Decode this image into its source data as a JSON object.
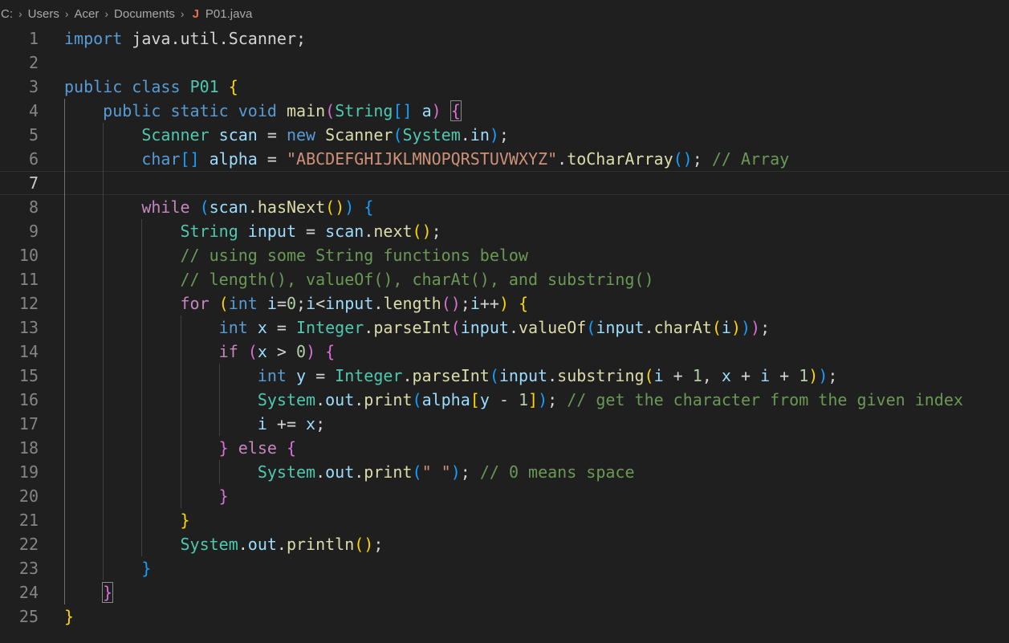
{
  "breadcrumb": {
    "items": [
      "C:",
      "Users",
      "Acer",
      "Documents"
    ],
    "file_icon": "J",
    "file": "P01.java"
  },
  "editor": {
    "language": "java",
    "current_line": 7,
    "lines": [
      {
        "n": "1",
        "t": [
          [
            "kw",
            "import"
          ],
          [
            "p",
            " java.util.Scanner;"
          ]
        ]
      },
      {
        "n": "2",
        "t": []
      },
      {
        "n": "3",
        "t": [
          [
            "kw",
            "public"
          ],
          [
            "p",
            " "
          ],
          [
            "kw",
            "class"
          ],
          [
            "p",
            " "
          ],
          [
            "ty",
            "P01"
          ],
          [
            "p",
            " "
          ],
          [
            "b1",
            "{"
          ]
        ]
      },
      {
        "n": "4",
        "t": [
          [
            "p",
            "    "
          ],
          [
            "kw",
            "public"
          ],
          [
            "p",
            " "
          ],
          [
            "kw",
            "static"
          ],
          [
            "p",
            " "
          ],
          [
            "kw",
            "void"
          ],
          [
            "p",
            " "
          ],
          [
            "fn",
            "main"
          ],
          [
            "b2",
            "("
          ],
          [
            "ty",
            "String"
          ],
          [
            "b3",
            "[]"
          ],
          [
            "p",
            " "
          ],
          [
            "var",
            "a"
          ],
          [
            "b2",
            ")"
          ],
          [
            "p",
            " "
          ],
          [
            "b2m",
            "{"
          ]
        ]
      },
      {
        "n": "5",
        "t": [
          [
            "p",
            "        "
          ],
          [
            "ty",
            "Scanner"
          ],
          [
            "p",
            " "
          ],
          [
            "var",
            "scan"
          ],
          [
            "p",
            " = "
          ],
          [
            "kw",
            "new"
          ],
          [
            "p",
            " "
          ],
          [
            "fn",
            "Scanner"
          ],
          [
            "b3",
            "("
          ],
          [
            "ty",
            "System"
          ],
          [
            "p",
            "."
          ],
          [
            "var",
            "in"
          ],
          [
            "b3",
            ")"
          ],
          [
            "p",
            ";"
          ]
        ]
      },
      {
        "n": "6",
        "t": [
          [
            "p",
            "        "
          ],
          [
            "kw",
            "char"
          ],
          [
            "b3",
            "[]"
          ],
          [
            "p",
            " "
          ],
          [
            "var",
            "alpha"
          ],
          [
            "p",
            " = "
          ],
          [
            "str",
            "\"ABCDEFGHIJKLMNOPQRSTUVWXYZ\""
          ],
          [
            "p",
            "."
          ],
          [
            "fn",
            "toCharArray"
          ],
          [
            "b3",
            "()"
          ],
          [
            "p",
            "; "
          ],
          [
            "cmt",
            "// Array"
          ]
        ]
      },
      {
        "n": "7",
        "t": []
      },
      {
        "n": "8",
        "t": [
          [
            "p",
            "        "
          ],
          [
            "ctl",
            "while"
          ],
          [
            "p",
            " "
          ],
          [
            "b3",
            "("
          ],
          [
            "var",
            "scan"
          ],
          [
            "p",
            "."
          ],
          [
            "fn",
            "hasNext"
          ],
          [
            "b1",
            "()"
          ],
          [
            "b3",
            ")"
          ],
          [
            "p",
            " "
          ],
          [
            "b3",
            "{"
          ]
        ]
      },
      {
        "n": "9",
        "t": [
          [
            "p",
            "            "
          ],
          [
            "ty",
            "String"
          ],
          [
            "p",
            " "
          ],
          [
            "var",
            "input"
          ],
          [
            "p",
            " = "
          ],
          [
            "var",
            "scan"
          ],
          [
            "p",
            "."
          ],
          [
            "fn",
            "next"
          ],
          [
            "b1",
            "()"
          ],
          [
            "p",
            ";"
          ]
        ]
      },
      {
        "n": "10",
        "t": [
          [
            "p",
            "            "
          ],
          [
            "cmt",
            "// using some String functions below"
          ]
        ]
      },
      {
        "n": "11",
        "t": [
          [
            "p",
            "            "
          ],
          [
            "cmt",
            "// length(), valueOf(), charAt(), and substring()"
          ]
        ]
      },
      {
        "n": "12",
        "t": [
          [
            "p",
            "            "
          ],
          [
            "ctl",
            "for"
          ],
          [
            "p",
            " "
          ],
          [
            "b1",
            "("
          ],
          [
            "kw",
            "int"
          ],
          [
            "p",
            " "
          ],
          [
            "var",
            "i"
          ],
          [
            "p",
            "="
          ],
          [
            "num",
            "0"
          ],
          [
            "p",
            ";"
          ],
          [
            "var",
            "i"
          ],
          [
            "p",
            "<"
          ],
          [
            "var",
            "input"
          ],
          [
            "p",
            "."
          ],
          [
            "fn",
            "length"
          ],
          [
            "b2",
            "()"
          ],
          [
            "p",
            ";"
          ],
          [
            "var",
            "i"
          ],
          [
            "p",
            "++"
          ],
          [
            "b1",
            ")"
          ],
          [
            "p",
            " "
          ],
          [
            "b1",
            "{"
          ]
        ]
      },
      {
        "n": "13",
        "t": [
          [
            "p",
            "                "
          ],
          [
            "kw",
            "int"
          ],
          [
            "p",
            " "
          ],
          [
            "var",
            "x"
          ],
          [
            "p",
            " = "
          ],
          [
            "ty",
            "Integer"
          ],
          [
            "p",
            "."
          ],
          [
            "fn",
            "parseInt"
          ],
          [
            "b2",
            "("
          ],
          [
            "var",
            "input"
          ],
          [
            "p",
            "."
          ],
          [
            "fn",
            "valueOf"
          ],
          [
            "b3",
            "("
          ],
          [
            "var",
            "input"
          ],
          [
            "p",
            "."
          ],
          [
            "fn",
            "charAt"
          ],
          [
            "b1",
            "("
          ],
          [
            "var",
            "i"
          ],
          [
            "b1",
            ")"
          ],
          [
            "b3",
            ")"
          ],
          [
            "b2",
            ")"
          ],
          [
            "p",
            ";"
          ]
        ]
      },
      {
        "n": "14",
        "t": [
          [
            "p",
            "                "
          ],
          [
            "ctl",
            "if"
          ],
          [
            "p",
            " "
          ],
          [
            "b2",
            "("
          ],
          [
            "var",
            "x"
          ],
          [
            "p",
            " > "
          ],
          [
            "num",
            "0"
          ],
          [
            "b2",
            ")"
          ],
          [
            "p",
            " "
          ],
          [
            "b2",
            "{"
          ]
        ]
      },
      {
        "n": "15",
        "t": [
          [
            "p",
            "                    "
          ],
          [
            "kw",
            "int"
          ],
          [
            "p",
            " "
          ],
          [
            "var",
            "y"
          ],
          [
            "p",
            " = "
          ],
          [
            "ty",
            "Integer"
          ],
          [
            "p",
            "."
          ],
          [
            "fn",
            "parseInt"
          ],
          [
            "b3",
            "("
          ],
          [
            "var",
            "input"
          ],
          [
            "p",
            "."
          ],
          [
            "fn",
            "substring"
          ],
          [
            "b1",
            "("
          ],
          [
            "var",
            "i"
          ],
          [
            "p",
            " + "
          ],
          [
            "num",
            "1"
          ],
          [
            "p",
            ", "
          ],
          [
            "var",
            "x"
          ],
          [
            "p",
            " + "
          ],
          [
            "var",
            "i"
          ],
          [
            "p",
            " + "
          ],
          [
            "num",
            "1"
          ],
          [
            "b1",
            ")"
          ],
          [
            "b3",
            ")"
          ],
          [
            "p",
            ";"
          ]
        ]
      },
      {
        "n": "16",
        "t": [
          [
            "p",
            "                    "
          ],
          [
            "ty",
            "System"
          ],
          [
            "p",
            "."
          ],
          [
            "var",
            "out"
          ],
          [
            "p",
            "."
          ],
          [
            "fn",
            "print"
          ],
          [
            "b3",
            "("
          ],
          [
            "var",
            "alpha"
          ],
          [
            "b1",
            "["
          ],
          [
            "var",
            "y"
          ],
          [
            "p",
            " - "
          ],
          [
            "num",
            "1"
          ],
          [
            "b1",
            "]"
          ],
          [
            "b3",
            ")"
          ],
          [
            "p",
            "; "
          ],
          [
            "cmt",
            "// get the character from the given index"
          ]
        ]
      },
      {
        "n": "17",
        "t": [
          [
            "p",
            "                    "
          ],
          [
            "var",
            "i"
          ],
          [
            "p",
            " += "
          ],
          [
            "var",
            "x"
          ],
          [
            "p",
            ";"
          ]
        ]
      },
      {
        "n": "18",
        "t": [
          [
            "p",
            "                "
          ],
          [
            "b2",
            "}"
          ],
          [
            "p",
            " "
          ],
          [
            "ctl",
            "else"
          ],
          [
            "p",
            " "
          ],
          [
            "b2",
            "{"
          ]
        ]
      },
      {
        "n": "19",
        "t": [
          [
            "p",
            "                    "
          ],
          [
            "ty",
            "System"
          ],
          [
            "p",
            "."
          ],
          [
            "var",
            "out"
          ],
          [
            "p",
            "."
          ],
          [
            "fn",
            "print"
          ],
          [
            "b3",
            "("
          ],
          [
            "str",
            "\" \""
          ],
          [
            "b3",
            ")"
          ],
          [
            "p",
            "; "
          ],
          [
            "cmt",
            "// 0 means space"
          ]
        ]
      },
      {
        "n": "20",
        "t": [
          [
            "p",
            "                "
          ],
          [
            "b2",
            "}"
          ]
        ]
      },
      {
        "n": "21",
        "t": [
          [
            "p",
            "            "
          ],
          [
            "b1",
            "}"
          ]
        ]
      },
      {
        "n": "22",
        "t": [
          [
            "p",
            "            "
          ],
          [
            "ty",
            "System"
          ],
          [
            "p",
            "."
          ],
          [
            "var",
            "out"
          ],
          [
            "p",
            "."
          ],
          [
            "fn",
            "println"
          ],
          [
            "b1",
            "()"
          ],
          [
            "p",
            ";"
          ]
        ]
      },
      {
        "n": "23",
        "t": [
          [
            "p",
            "        "
          ],
          [
            "b3",
            "}"
          ]
        ]
      },
      {
        "n": "24",
        "t": [
          [
            "p",
            "    "
          ],
          [
            "b2m",
            "}"
          ]
        ]
      },
      {
        "n": "25",
        "t": [
          [
            "b1",
            "}"
          ]
        ]
      }
    ]
  }
}
